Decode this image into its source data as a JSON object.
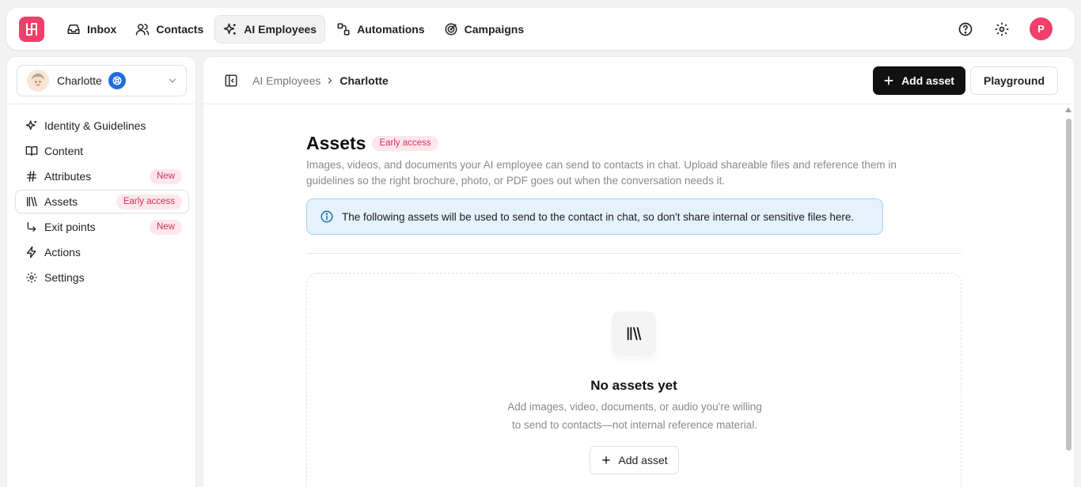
{
  "topnav": {
    "items": [
      {
        "label": "Inbox",
        "icon": "inbox-icon"
      },
      {
        "label": "Contacts",
        "icon": "users-icon"
      },
      {
        "label": "AI Employees",
        "icon": "sparkles-icon",
        "active": true
      },
      {
        "label": "Automations",
        "icon": "workflow-icon"
      },
      {
        "label": "Campaigns",
        "icon": "target-icon"
      }
    ],
    "avatar_initial": "P"
  },
  "sidebar": {
    "agent_name": "Charlotte",
    "items": [
      {
        "label": "Identity & Guidelines",
        "icon": "sparkles-icon"
      },
      {
        "label": "Content",
        "icon": "book-icon"
      },
      {
        "label": "Attributes",
        "icon": "hash-icon",
        "badge": "New"
      },
      {
        "label": "Assets",
        "icon": "library-icon",
        "badge": "Early access",
        "active": true
      },
      {
        "label": "Exit points",
        "icon": "corner-arrow-icon",
        "badge": "New"
      },
      {
        "label": "Actions",
        "icon": "bolt-icon"
      },
      {
        "label": "Settings",
        "icon": "gear-icon"
      }
    ]
  },
  "header": {
    "breadcrumb_parent": "AI Employees",
    "breadcrumb_current": "Charlotte",
    "add_asset_label": "Add asset",
    "playground_label": "Playground"
  },
  "page": {
    "title": "Assets",
    "badge": "Early access",
    "description": "Images, videos, and documents your AI employee can send to contacts in chat. Upload shareable files and reference them in guidelines so the right brochure, photo, or PDF goes out when the conversation needs it.",
    "alert": "The following assets will be used to send to the contact in chat, so don't share internal or sensitive files here.",
    "empty_title": "No assets yet",
    "empty_desc_line1": "Add images, video, documents, or audio you're willing",
    "empty_desc_line2": "to send to contacts—not internal reference material.",
    "empty_button": "Add asset"
  },
  "colors": {
    "brand": "#ef3f6a",
    "badge_bg": "#fde7ec",
    "badge_text": "#d6335b",
    "alert_bg": "#e4f2fb",
    "alert_border": "#a9d3ee",
    "primary_button": "#111111"
  }
}
